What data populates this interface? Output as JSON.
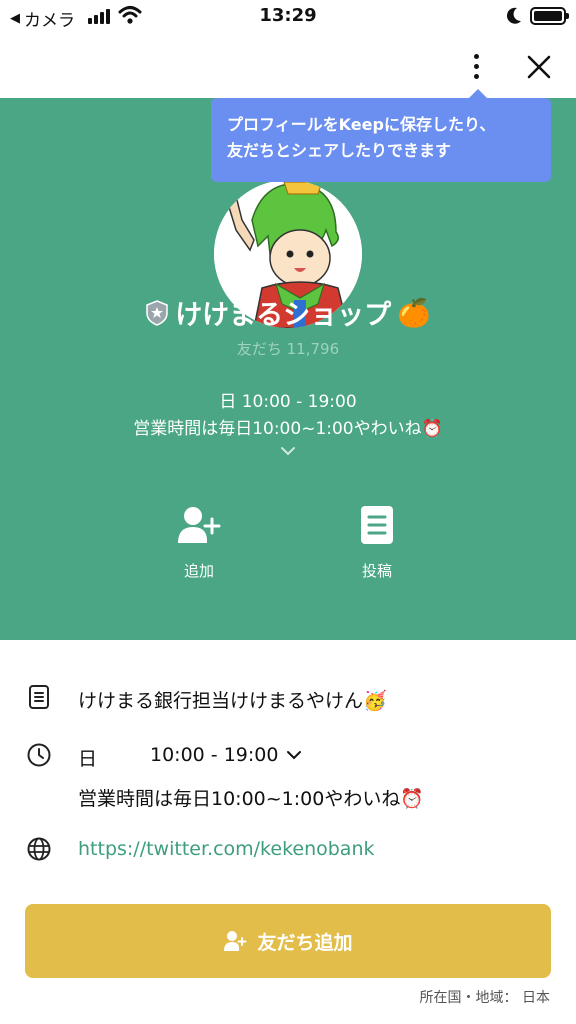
{
  "status_bar": {
    "back_label": "カメラ",
    "time": "13:29"
  },
  "tooltip": {
    "line1": "プロフィールをKeepに保存したり、",
    "line2": "友だちとシェアしたりできます"
  },
  "profile": {
    "name": "けけまるショップ",
    "friends_label": "友だち 11,796",
    "hours_line": "日 10:00 - 19:00",
    "hours_note": "営業時間は毎日10:00~1:00やわいね⏰",
    "name_emoji": "🍊"
  },
  "actions": {
    "add_label": "追加",
    "post_label": "投稿"
  },
  "info": {
    "description": "けけまる銀行担当けけまるやけん🥳",
    "day": "日",
    "hours_range": "10:00 - 19:00",
    "hours_note": "営業時間は毎日10:00~1:00やわいね⏰",
    "website": "https://twitter.com/kekenobank"
  },
  "add_friend_button": "友だち追加",
  "region": "所在国・地域： 日本",
  "colors": {
    "hero_green": "#4aa685",
    "tooltip_blue": "#6b8ff0",
    "button_yellow": "#e3bd4a",
    "link_green": "#3e9e7b"
  }
}
